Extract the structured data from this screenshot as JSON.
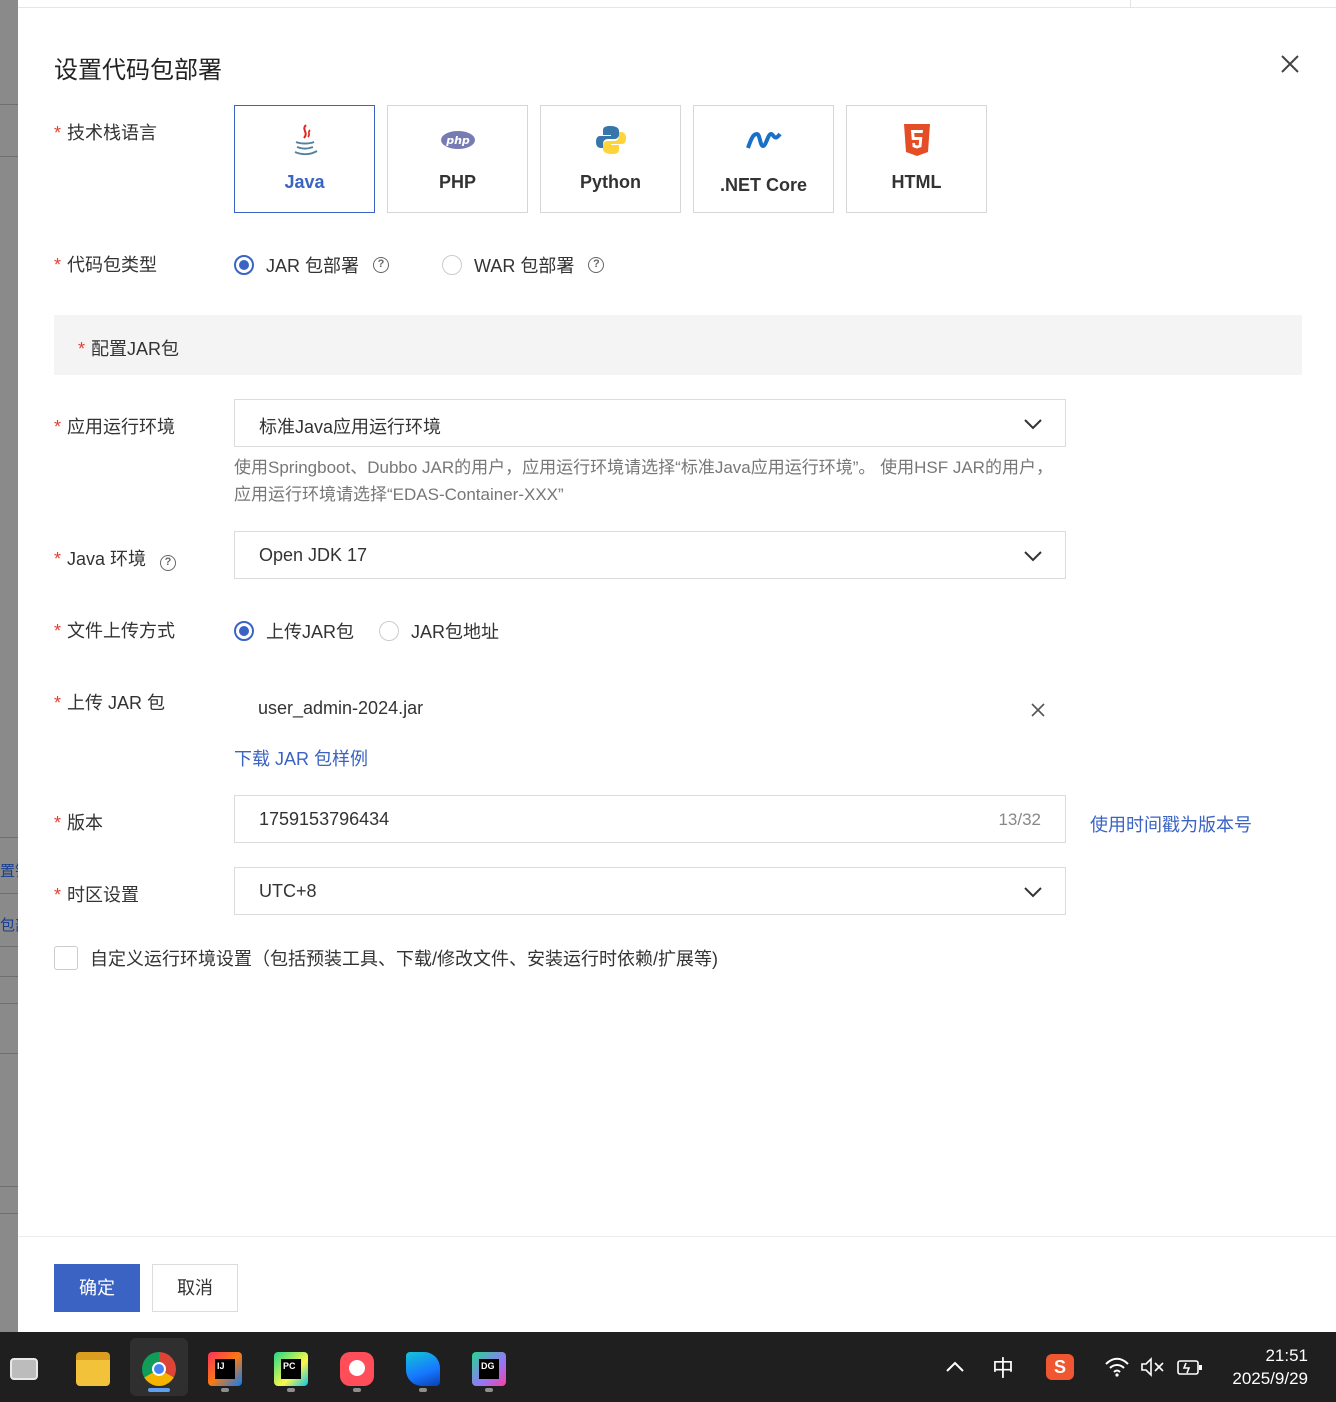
{
  "background": {
    "fragments": [
      "置镜",
      "包部"
    ]
  },
  "dialog": {
    "title": "设置代码包部署",
    "close_icon": "close-icon"
  },
  "form": {
    "tech_stack": {
      "label": "技术栈语言",
      "options": [
        {
          "name": "Java",
          "icon": "java-icon",
          "selected": true
        },
        {
          "name": "PHP",
          "icon": "php-icon",
          "selected": false
        },
        {
          "name": "Python",
          "icon": "python-icon",
          "selected": false
        },
        {
          "name": ".NET Core",
          "icon": "dotnet-icon",
          "selected": false
        },
        {
          "name": "HTML",
          "icon": "html5-icon",
          "selected": false
        }
      ]
    },
    "package_type": {
      "label": "代码包类型",
      "options": [
        {
          "label": "JAR 包部署",
          "selected": true
        },
        {
          "label": "WAR 包部署",
          "selected": false
        }
      ]
    },
    "section_title": "配置JAR包",
    "runtime": {
      "label": "应用运行环境",
      "value": "标准Java应用运行环境",
      "hint": "使用Springboot、Dubbo JAR的用户，应用运行环境请选择“标准Java应用运行环境”。 使用HSF JAR的用户，应用运行环境请选择“EDAS-Container-XXX”"
    },
    "java_env": {
      "label": "Java 环境",
      "value": "Open JDK 17"
    },
    "upload_method": {
      "label": "文件上传方式",
      "options": [
        {
          "label": "上传JAR包",
          "selected": true
        },
        {
          "label": "JAR包地址",
          "selected": false
        }
      ]
    },
    "upload_jar": {
      "label": "上传 JAR 包",
      "file_name": "user_admin-2024.jar",
      "sample_link": "下载 JAR 包样例"
    },
    "version": {
      "label": "版本",
      "value": "1759153796434",
      "counter": "13/32",
      "timestamp_link": "使用时间戳为版本号"
    },
    "timezone": {
      "label": "时区设置",
      "value": "UTC+8"
    },
    "custom_env": {
      "label": "自定义运行环境设置（包括预装工具、下载/修改文件、安装运行时依赖/扩展等)",
      "checked": false
    }
  },
  "footer": {
    "confirm": "确定",
    "cancel": "取消"
  },
  "taskbar": {
    "apps": [
      "task-view-icon",
      "file-explorer-icon",
      "chrome-icon",
      "intellij-icon",
      "pycharm-icon",
      "app-icon",
      "edge-like-icon",
      "datagrip-icon"
    ],
    "tray": {
      "ime": "中",
      "time": "21:51",
      "date": "2025/9/29"
    }
  },
  "colors": {
    "primary": "#3a63c4",
    "required": "#e33e33",
    "taskbar": "#1f1f1f"
  }
}
